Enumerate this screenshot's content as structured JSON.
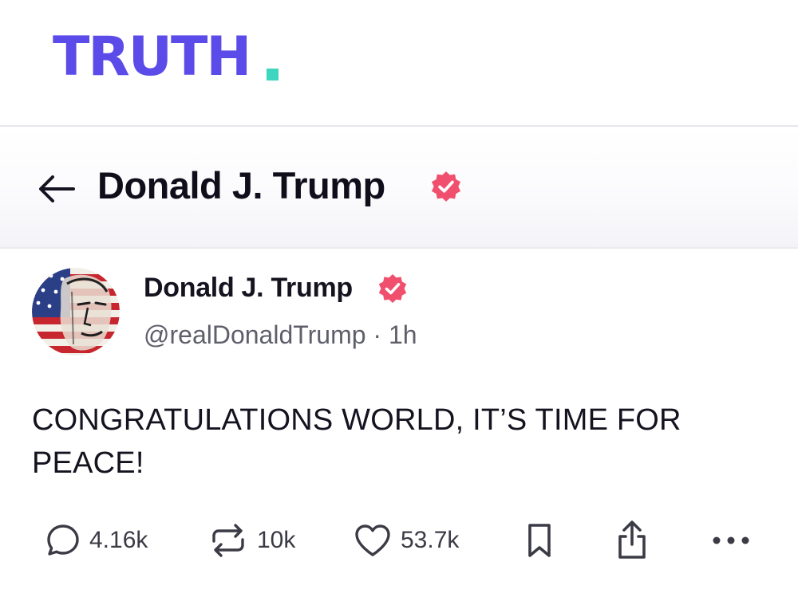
{
  "app": {
    "logo_text": "TRUTH",
    "brand_color": "#5b4be8",
    "accent_color": "#3fd6bf",
    "verified_color": "#f0506e"
  },
  "header": {
    "title": "Donald J. Trump",
    "back_icon": "arrow-left-icon",
    "badge_icon": "verified-badge-icon"
  },
  "post": {
    "author_name": "Donald J. Trump",
    "handle": "@realDonaldTrump",
    "separator": "·",
    "time": "1h",
    "text": "CONGRATULATIONS WORLD, IT’S TIME FOR PEACE!",
    "actions": {
      "replies": "4.16k",
      "reposts": "10k",
      "likes": "53.7k",
      "bookmark_icon": "bookmark-icon",
      "share_icon": "share-icon",
      "more_icon": "more-horizontal-icon"
    }
  }
}
